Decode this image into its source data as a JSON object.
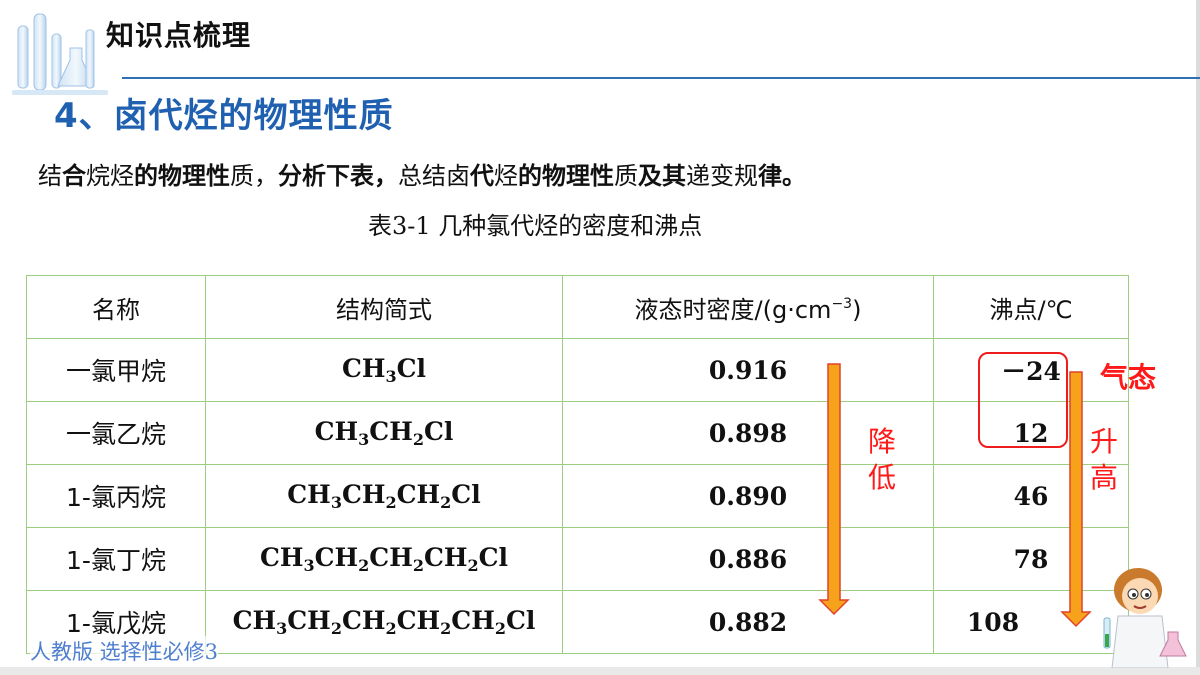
{
  "header": {
    "section_tag": "知识点梳理",
    "heading": "4、卤代烃的物理性质"
  },
  "instruction": {
    "parts": [
      "结",
      "合",
      "烷烃",
      "的物理性",
      "质，",
      "分析下表，",
      "总结卤",
      "代",
      "烃",
      "的物理性",
      "质",
      "及其",
      "递变规",
      "律。"
    ]
  },
  "table": {
    "caption": "表3-1  几种氯代烃的密度和沸点",
    "headers": {
      "name": "名称",
      "formula": "结构简式",
      "density": "液态时密度/(g·cm",
      "density_sup": "−3",
      "density_close": ")",
      "bp": "沸点/℃"
    },
    "rows": [
      {
        "name": "一氯甲烷",
        "formula_parts": [
          "CH",
          "3",
          "Cl",
          "",
          ""
        ],
        "density": "0.916",
        "bp": "－24"
      },
      {
        "name": "一氯乙烷",
        "formula_parts": [
          "CH",
          "3",
          "CH",
          "2",
          "Cl"
        ],
        "density": "0.898",
        "bp": "12"
      },
      {
        "name": "1-氯丙烷",
        "formula": "CH3CH2CH2Cl",
        "density": "0.890",
        "bp": "46"
      },
      {
        "name": "1-氯丁烷",
        "formula": "CH3CH2CH2CH2Cl",
        "density": "0.886",
        "bp": "78"
      },
      {
        "name": "1-氯戊烷",
        "formula": "CH3CH2CH2CH2CH2Cl",
        "density": "0.882",
        "bp": "108"
      }
    ]
  },
  "annotations": {
    "density_trend": [
      "降",
      "低"
    ],
    "bp_trend": [
      "升",
      "高"
    ],
    "gas_state": "气态"
  },
  "footer": "人教版 选择性必修3",
  "colors": {
    "heading": "#2060b0",
    "annotation_red": "#ff1a1a",
    "arrow_fill": "#f7a21b",
    "table_border": "#9bcf7f",
    "footer": "#4f7fd0"
  }
}
